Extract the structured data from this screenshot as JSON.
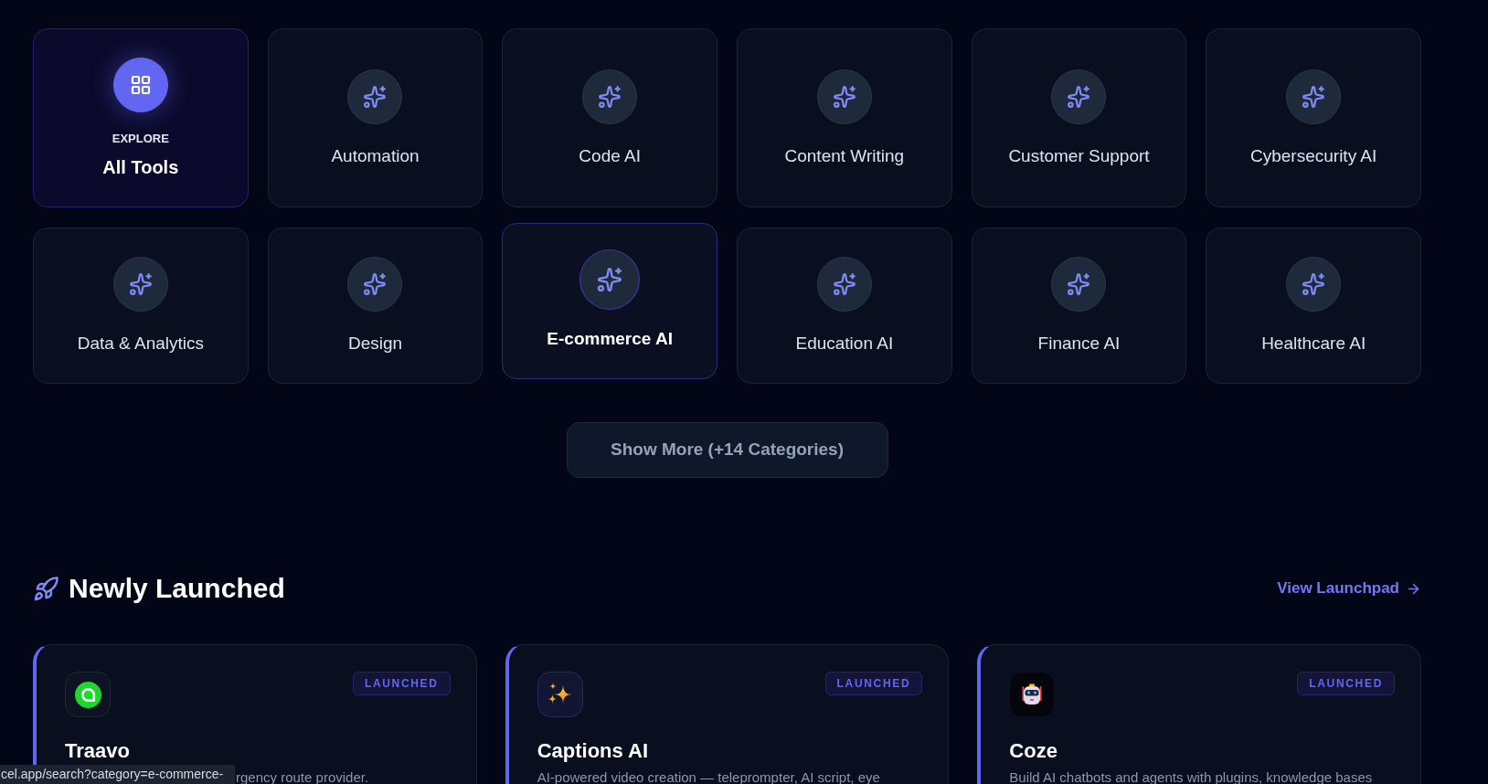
{
  "categories": {
    "items": [
      {
        "kind": "explore",
        "eyebrow": "EXPLORE",
        "label": "All Tools",
        "selected": true,
        "hovered": false
      },
      {
        "kind": "category",
        "label": "Automation",
        "selected": false,
        "hovered": false
      },
      {
        "kind": "category",
        "label": "Code AI",
        "selected": false,
        "hovered": false
      },
      {
        "kind": "category",
        "label": "Content Writing",
        "selected": false,
        "hovered": false
      },
      {
        "kind": "category",
        "label": "Customer Support",
        "selected": false,
        "hovered": false
      },
      {
        "kind": "category",
        "label": "Cybersecurity AI",
        "selected": false,
        "hovered": false
      },
      {
        "kind": "category",
        "label": "Data & Analytics",
        "selected": false,
        "hovered": false
      },
      {
        "kind": "category",
        "label": "Design",
        "selected": false,
        "hovered": false
      },
      {
        "kind": "category",
        "label": "E-commerce AI",
        "selected": false,
        "hovered": true
      },
      {
        "kind": "category",
        "label": "Education AI",
        "selected": false,
        "hovered": false
      },
      {
        "kind": "category",
        "label": "Finance AI",
        "selected": false,
        "hovered": false
      },
      {
        "kind": "category",
        "label": "Healthcare AI",
        "selected": false,
        "hovered": false
      }
    ],
    "show_more": "Show More (+14 Categories)"
  },
  "newly_launched": {
    "title": "Newly Launched",
    "link": "View Launchpad",
    "cards": [
      {
        "name": "Traavo",
        "badge": "LAUNCHED",
        "description": "rgency route provider.",
        "description_start_hidden": true
      },
      {
        "name": "Captions AI",
        "badge": "LAUNCHED",
        "description": "AI-powered video creation — teleprompter, AI script, eye",
        "description_start_hidden": false
      },
      {
        "name": "Coze",
        "badge": "LAUNCHED",
        "description": "Build AI chatbots and agents with plugins, knowledge bases",
        "description_start_hidden": false
      }
    ]
  },
  "status_bar": {
    "url": "cel.app/search?category=e-commerce-"
  }
}
